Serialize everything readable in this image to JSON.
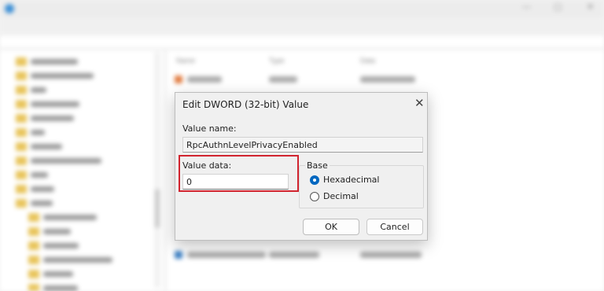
{
  "dialog": {
    "title": "Edit DWORD (32-bit) Value",
    "value_name_label": "Value name:",
    "value_name": "RpcAuthnLevelPrivacyEnabled",
    "value_data_label": "Value data:",
    "value_data": "0",
    "base_label": "Base",
    "base_options": [
      {
        "label": "Hexadecimal",
        "selected": true
      },
      {
        "label": "Decimal",
        "selected": false
      }
    ],
    "ok_label": "OK",
    "cancel_label": "Cancel",
    "highlight_color": "#d1242f",
    "accent_color": "#0067c0"
  },
  "background": {
    "list_headers": [
      "Name",
      "Type",
      "Data"
    ]
  },
  "icons": {
    "close": "close-icon",
    "app": "registry-editor-icon",
    "folder": "folder-icon"
  }
}
